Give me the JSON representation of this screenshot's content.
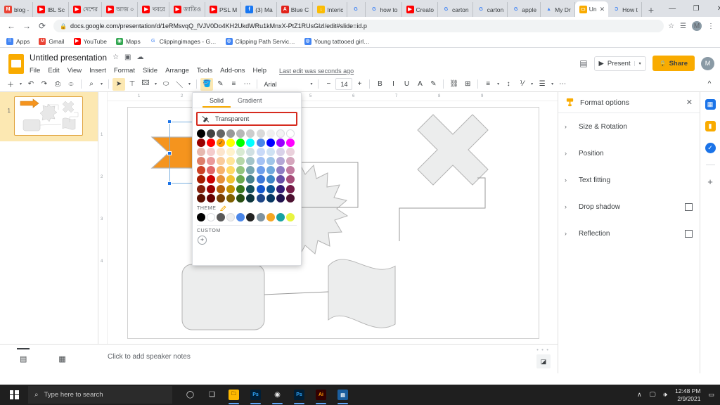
{
  "browser": {
    "tabs": [
      {
        "label": "blog -",
        "icon": "gmail-icon",
        "color": "#ea4335",
        "glyph": "M"
      },
      {
        "label": "IBL Sc",
        "icon": "youtube-icon",
        "color": "#ff0000",
        "glyph": "▶"
      },
      {
        "label": "দেশের",
        "icon": "youtube-icon",
        "color": "#ff0000",
        "glyph": "▶"
      },
      {
        "label": "আজ ০",
        "icon": "youtube-icon",
        "color": "#ff0000",
        "glyph": "▶"
      },
      {
        "label": "খবরে",
        "icon": "youtube-icon",
        "color": "#ff0000",
        "glyph": "▶"
      },
      {
        "label": "জাতিও",
        "icon": "youtube-icon",
        "color": "#ff0000",
        "glyph": "▶"
      },
      {
        "label": "PSL M",
        "icon": "youtube-icon",
        "color": "#ff0000",
        "glyph": "▶"
      },
      {
        "label": "(3) Ma",
        "icon": "facebook-icon",
        "color": "#1877f2",
        "glyph": "f"
      },
      {
        "label": "Blue C",
        "icon": "pdf-icon",
        "color": "#e2231a",
        "glyph": "A"
      },
      {
        "label": "Interic",
        "icon": "download-icon",
        "color": "#fbbc04",
        "glyph": "↓"
      },
      {
        "label": "",
        "icon": "google-icon",
        "color": "#ffffff",
        "glyph": "G"
      },
      {
        "label": "how to",
        "icon": "google-icon",
        "color": "#ffffff",
        "glyph": "G"
      },
      {
        "label": "Creato",
        "icon": "youtube-icon",
        "color": "#ff0000",
        "glyph": "▶"
      },
      {
        "label": "carton",
        "icon": "google-icon",
        "color": "#ffffff",
        "glyph": "G"
      },
      {
        "label": "carton",
        "icon": "google-icon",
        "color": "#ffffff",
        "glyph": "G"
      },
      {
        "label": "apple",
        "icon": "google-icon",
        "color": "#ffffff",
        "glyph": "G"
      },
      {
        "label": "My Dr",
        "icon": "google-drive-icon",
        "color": "#ffffff",
        "glyph": "▲"
      },
      {
        "label": "Un",
        "icon": "google-slides-icon",
        "color": "#f9ab00",
        "glyph": "▭",
        "active": true,
        "close": "✕"
      },
      {
        "label": "How t",
        "icon": "edge-icon",
        "color": "#ffffff",
        "glyph": "Ɔ"
      }
    ],
    "new_tab": "+",
    "window_buttons": {
      "minimize": "—",
      "maximize": "❐",
      "close": "✕"
    },
    "nav": {
      "back": "←",
      "forward": "→",
      "reload": "⟳"
    },
    "url": "docs.google.com/presentation/d/1eRMsvqQ_fVJV0Do4KH2UkdWRu1kMnxX-PtZ1RUsGlzl/edit#slide=id.p",
    "lock_icon": "🔒",
    "omni_icons": {
      "star": "☆",
      "reading_list": "☰",
      "avatar": "M",
      "menu": "⋮"
    },
    "bookmarks": [
      {
        "label": "Apps",
        "icon": "apps-grid-icon",
        "color": "#4285f4",
        "glyph": "⠿"
      },
      {
        "label": "Gmail",
        "icon": "gmail-icon",
        "color": "#ea4335",
        "glyph": "M"
      },
      {
        "label": "YouTube",
        "icon": "youtube-icon",
        "color": "#ff0000",
        "glyph": "▶"
      },
      {
        "label": "Maps",
        "icon": "maps-pin-icon",
        "color": "#34a853",
        "glyph": "◉"
      },
      {
        "label": "Clippingimages - G…",
        "icon": "google-icon",
        "color": "#ffffff",
        "glyph": "G"
      },
      {
        "label": "Clipping Path Servic…",
        "icon": "globe-icon",
        "color": "#4285f4",
        "glyph": "◍"
      },
      {
        "label": "Young tattooed girl…",
        "icon": "globe-icon",
        "color": "#4285f4",
        "glyph": "◍"
      }
    ]
  },
  "slides": {
    "doc_title": "Untitled presentation",
    "title_icons": [
      {
        "name": "star-icon",
        "glyph": "☆"
      },
      {
        "name": "move-to-folder-icon",
        "glyph": "▣"
      },
      {
        "name": "cloud-saved-icon",
        "glyph": "☁"
      }
    ],
    "menus": [
      "File",
      "Edit",
      "View",
      "Insert",
      "Format",
      "Slide",
      "Arrange",
      "Tools",
      "Add-ons",
      "Help"
    ],
    "last_edit": "Last edit was seconds ago",
    "comment_icon": "▤",
    "present_label": "Present",
    "present_caret": "▾",
    "share_label": "Share",
    "share_lock": "🔒",
    "account_initial": "M",
    "toolbar": {
      "left_items": [
        {
          "name": "new-slide-button",
          "glyph": "＋"
        },
        {
          "name": "new-slide-caret",
          "glyph": "▾",
          "caret": true
        },
        {
          "name": "undo-button",
          "glyph": "↶"
        },
        {
          "name": "redo-button",
          "glyph": "↷"
        },
        {
          "name": "print-button",
          "glyph": "⎙"
        },
        {
          "name": "paint-format-button",
          "glyph": "⌯"
        }
      ],
      "zoom_items": [
        {
          "name": "zoom-button",
          "glyph": "⌕"
        },
        {
          "name": "zoom-caret",
          "glyph": "▾",
          "caret": true
        }
      ],
      "insert_items": [
        {
          "name": "select-tool-button",
          "glyph": "➤",
          "highlight": true
        },
        {
          "name": "textbox-button",
          "glyph": "⊤"
        },
        {
          "name": "image-button",
          "glyph": "🖾"
        },
        {
          "name": "image-caret",
          "glyph": "▾",
          "caret": true
        },
        {
          "name": "shape-button",
          "glyph": "⬭"
        },
        {
          "name": "line-button",
          "glyph": "＼"
        },
        {
          "name": "line-caret",
          "glyph": "▾",
          "caret": true
        }
      ],
      "format_items": [
        {
          "name": "fill-color-button",
          "glyph": "🪣",
          "highlight": true
        },
        {
          "name": "border-color-button",
          "glyph": "✎"
        },
        {
          "name": "border-weight-button",
          "glyph": "≡"
        },
        {
          "name": "border-dash-button",
          "glyph": "⋯"
        }
      ],
      "font_family": "Arial",
      "font_caret": "▾",
      "font_size_minus": "−",
      "font_size": "14",
      "font_size_plus": "+",
      "text_items": [
        {
          "name": "bold-button",
          "glyph": "B"
        },
        {
          "name": "italic-button",
          "glyph": "I"
        },
        {
          "name": "underline-button",
          "glyph": "U"
        },
        {
          "name": "text-color-button",
          "glyph": "A"
        },
        {
          "name": "highlight-color-button",
          "glyph": "✎"
        }
      ],
      "insert2_items": [
        {
          "name": "insert-link-button",
          "glyph": "⛓"
        },
        {
          "name": "insert-comment-button",
          "glyph": "⊞"
        }
      ],
      "align_items": [
        {
          "name": "align-button",
          "glyph": "≡"
        },
        {
          "name": "align-caret",
          "glyph": "▾",
          "caret": true
        },
        {
          "name": "line-spacing-button",
          "glyph": "↕"
        },
        {
          "name": "numbered-list-button",
          "glyph": "⅟"
        },
        {
          "name": "numbered-list-caret",
          "glyph": "▾",
          "caret": true
        },
        {
          "name": "bulleted-list-button",
          "glyph": "☰"
        },
        {
          "name": "bulleted-list-caret",
          "glyph": "▾",
          "caret": true
        },
        {
          "name": "more-options-button",
          "glyph": "⋯"
        }
      ],
      "collapse_glyph": "^"
    },
    "filmstrip": {
      "slide_number": "1"
    },
    "notes_placeholder": "Click to add speaker notes",
    "notes_grip": "• • •",
    "view_buttons": [
      {
        "name": "filmstrip-view-button",
        "glyph": "▤",
        "active": true
      },
      {
        "name": "grid-view-button",
        "glyph": "▦",
        "active": false
      }
    ],
    "explore_glyph": "◪",
    "ruler_h_ticks": [
      "1",
      "2",
      "3",
      "4",
      "5",
      "6",
      "7",
      "8",
      "9"
    ],
    "ruler_v_ticks": [
      "1",
      "2",
      "3",
      "4"
    ]
  },
  "color_picker": {
    "tabs": [
      {
        "label": "Solid",
        "active": true
      },
      {
        "label": "Gradient",
        "active": false
      }
    ],
    "transparent_label": "Transparent",
    "transparent_icon": "no-fill-icon",
    "highlight_border_color": "#d62b1f",
    "selected_swatch_index": 12,
    "selected_check_glyph": "✓",
    "theme_label": "THEME",
    "theme_edit_icon": "pencil-icon",
    "custom_label": "CUSTOM",
    "custom_add_glyph": "+",
    "grid": [
      [
        "#000000",
        "#434343",
        "#666666",
        "#999999",
        "#b7b7b7",
        "#cccccc",
        "#d9d9d9",
        "#efefef",
        "#f3f3f3",
        "#ffffff"
      ],
      [
        "#980000",
        "#ff0000",
        "#ff9900",
        "#ffff00",
        "#00ff00",
        "#00ffff",
        "#4a86e8",
        "#0000ff",
        "#9900ff",
        "#ff00ff"
      ],
      [
        "#e6b8af",
        "#f4cccc",
        "#fce5cd",
        "#fff2cc",
        "#d9ead3",
        "#d0e0e3",
        "#c9daf8",
        "#cfe2f3",
        "#d9d2e9",
        "#ead1dc"
      ],
      [
        "#dd7e6b",
        "#ea9999",
        "#f9cb9c",
        "#ffe599",
        "#b6d7a8",
        "#a2c4c9",
        "#a4c2f4",
        "#9fc5e8",
        "#b4a7d6",
        "#d5a6bd"
      ],
      [
        "#cc4125",
        "#e06666",
        "#f6b26b",
        "#ffd966",
        "#93c47d",
        "#76a5af",
        "#6d9eeb",
        "#6fa8dc",
        "#8e7cc3",
        "#c27ba0"
      ],
      [
        "#a61c00",
        "#cc0000",
        "#e69138",
        "#f1c232",
        "#6aa84f",
        "#45818e",
        "#3c78d8",
        "#3d85c6",
        "#674ea7",
        "#a64d79"
      ],
      [
        "#85200c",
        "#990000",
        "#b45f06",
        "#bf9000",
        "#38761d",
        "#134f5c",
        "#1155cc",
        "#0b5394",
        "#351c75",
        "#741b47"
      ],
      [
        "#5b0f00",
        "#660000",
        "#783f04",
        "#7f6000",
        "#274e13",
        "#0c343d",
        "#1c4587",
        "#073763",
        "#20124d",
        "#4c1130"
      ]
    ],
    "theme_colors": [
      "#000000",
      "#ffffff",
      "#595959",
      "#eeeeee",
      "#4a86e8",
      "#222222",
      "#7f93a0",
      "#f5a councils"
    ]
  },
  "format_options": {
    "panel_icon": "format-brush-icon",
    "title": "Format options",
    "close_glyph": "✕",
    "items": [
      {
        "label": "Size & Rotation",
        "chevron": "›",
        "checkbox": false
      },
      {
        "label": "Position",
        "chevron": "›",
        "checkbox": false
      },
      {
        "label": "Text fitting",
        "chevron": "›",
        "checkbox": false
      },
      {
        "label": "Drop shadow",
        "chevron": "›",
        "checkbox": true
      },
      {
        "label": "Reflection",
        "chevron": "›",
        "checkbox": true
      }
    ]
  },
  "rail": [
    {
      "name": "calendar-icon",
      "color": "#1a73e8",
      "glyph": "▦"
    },
    {
      "name": "keep-icon",
      "color": "#f9ab00",
      "glyph": "▮"
    },
    {
      "name": "tasks-icon",
      "color": "#1a73e8",
      "glyph": "✓"
    },
    {
      "name": "rail-divider",
      "color": "",
      "glyph": ""
    },
    {
      "name": "add-addon-icon",
      "color": "",
      "glyph": "+"
    }
  ],
  "taskbar": {
    "start_icon": "windows-start-icon",
    "search_placeholder": "Type here to search",
    "search_icon": "search-icon",
    "items": [
      {
        "name": "cortana-icon",
        "glyph": "◯",
        "color": "",
        "running": false
      },
      {
        "name": "task-view-icon",
        "glyph": "❑",
        "color": "",
        "running": false
      },
      {
        "name": "file-explorer-icon",
        "glyph": "🗀",
        "color": "#ffb900",
        "running": true
      },
      {
        "name": "photoshop-taskbar-icon",
        "glyph": "Ps",
        "color": "#001e36",
        "running": true
      },
      {
        "name": "chrome-icon",
        "glyph": "◉",
        "color": "",
        "running": true
      },
      {
        "name": "photoshop-icon",
        "glyph": "Ps",
        "color": "#001e36",
        "running": true
      },
      {
        "name": "illustrator-icon",
        "glyph": "Ai",
        "color": "#330000",
        "running": true
      },
      {
        "name": "slides-app-icon",
        "glyph": "▤",
        "color": "#1b5e9e",
        "running": true
      }
    ],
    "tray": {
      "chevron": "∧",
      "network_icon": "🖳",
      "volume_icon": "🔊",
      "time": "12:48 PM",
      "date": "2/9/2021",
      "action_center_icon": "▭"
    }
  }
}
